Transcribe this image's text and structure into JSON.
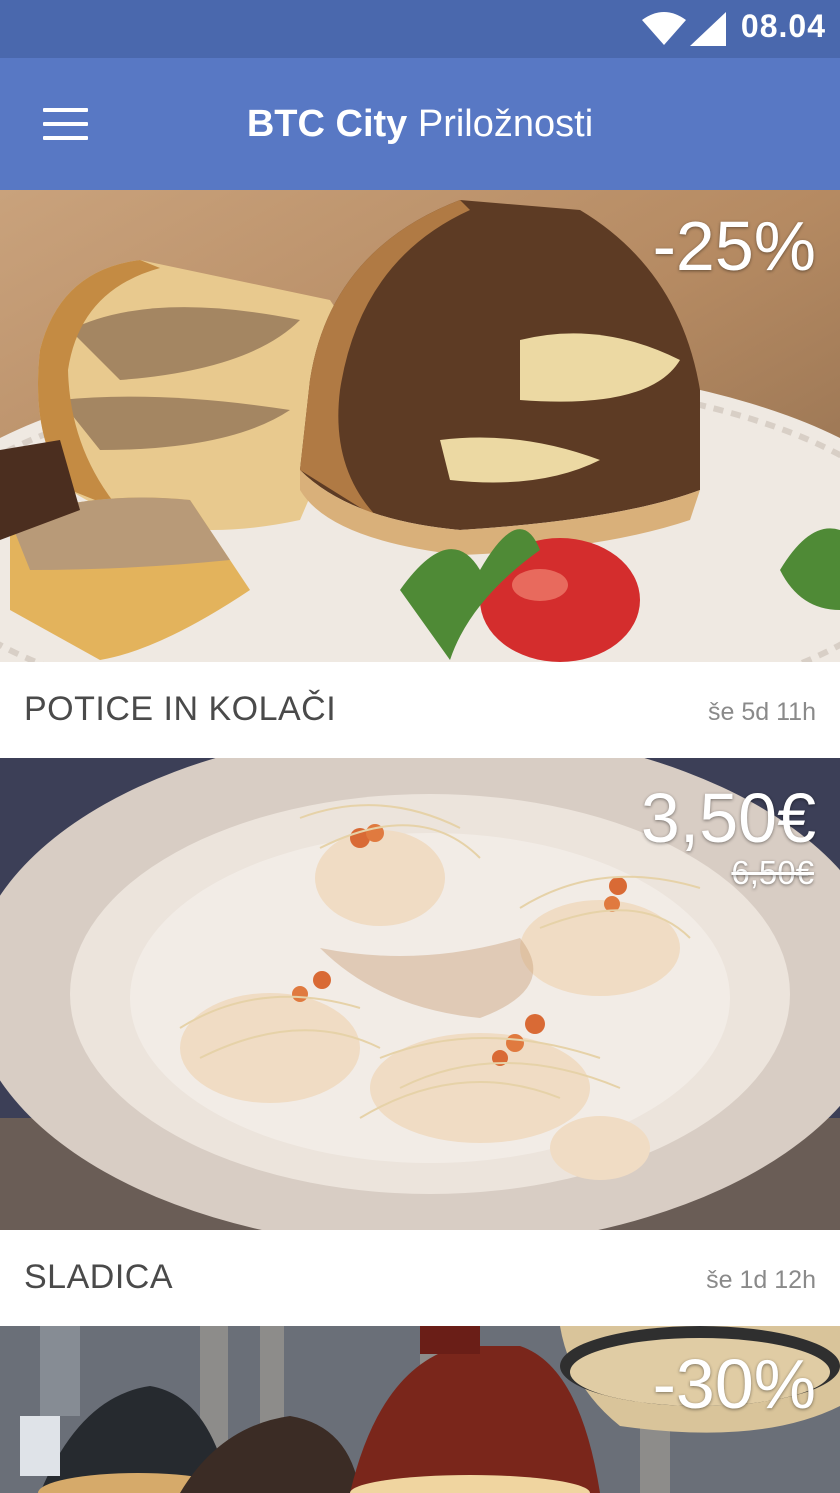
{
  "status_bar": {
    "time": "08.04",
    "icons": [
      "wifi-icon",
      "cell-signal-icon"
    ]
  },
  "app_bar": {
    "brand": "BTC City",
    "title": "Priložnosti",
    "menu_icon": "hamburger-menu-icon",
    "color": "#5878c4",
    "status_color": "#4a68ad"
  },
  "offers": [
    {
      "title": "POTICE IN KOLAČI",
      "remaining": "še 5d 11h",
      "discount": "-25%"
    },
    {
      "title": "SLADICA",
      "remaining": "še 1d 12h",
      "price": "3,50€",
      "old_price": "6,50€"
    },
    {
      "discount": "-30%"
    }
  ]
}
